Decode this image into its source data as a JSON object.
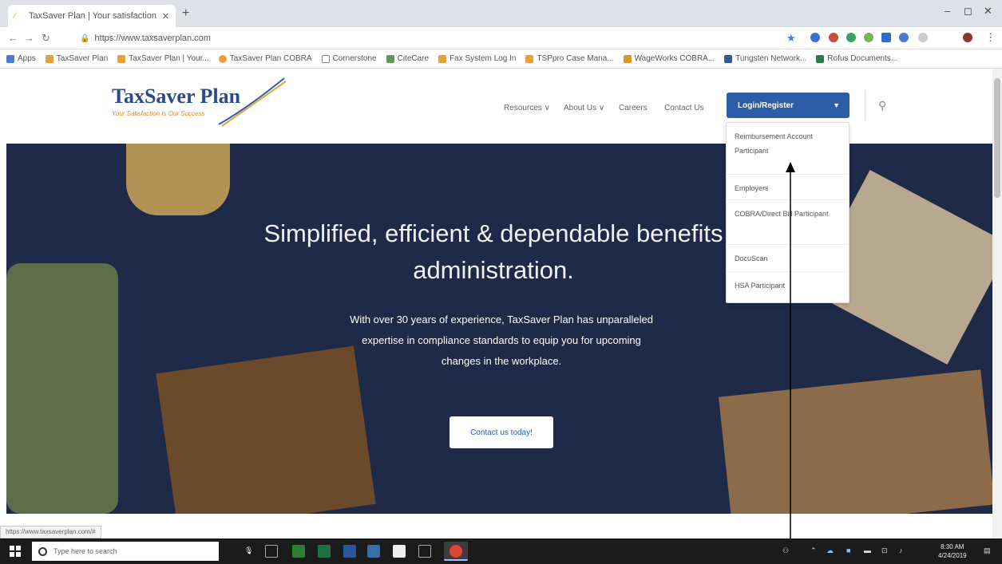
{
  "browser": {
    "tab_title": "TaxSaver Plan | Your satisfaction",
    "url": "https://www.taxsaverplan.com",
    "bookmarks": [
      {
        "label": "Apps",
        "color": "#4a7ad9"
      },
      {
        "label": "TaxSaver Plan",
        "color": "#e6a13c"
      },
      {
        "label": "TaxSaver Plan | Your...",
        "color": "#e6a13c"
      },
      {
        "label": "TaxSaver Plan COBRA",
        "color": "#e6a13c"
      },
      {
        "label": "Cornerstone",
        "color": "#888888"
      },
      {
        "label": "CiteCare",
        "color": "#5a9a5a"
      },
      {
        "label": "Fax System Log In",
        "color": "#e6a13c"
      },
      {
        "label": "TSPpro Case Mana...",
        "color": "#e6a13c"
      },
      {
        "label": "WageWorks COBRA...",
        "color": "#d99a2b"
      },
      {
        "label": "Tungsten Network...",
        "color": "#3b5998"
      },
      {
        "label": "Rofus Documents...",
        "color": "#2f7a4a"
      }
    ],
    "status_url": "https://www.taxsaverplan.com/#"
  },
  "site": {
    "brand": "TaxSaver Plan",
    "tagline": "Your Satisfaction Is Our Success",
    "nav": {
      "resources": "Resources ∨",
      "about": "About Us ∨",
      "careers": "Careers",
      "contact": "Contact Us",
      "login": "Login/Register"
    },
    "dropdown": [
      "Reimbursement Account Participant",
      "Employers",
      "COBRA/Direct Bill Participant",
      "DocuScan",
      "HSA Participant"
    ],
    "hero": {
      "headline_line1": "Simplified, efficient & dependable benefits",
      "headline_line2": "administration.",
      "sub_line1": "With over 30 years of experience, TaxSaver Plan has unparalleled",
      "sub_line2": "expertise in compliance standards to equip you for upcoming",
      "sub_line3": "changes in the workplace.",
      "cta": "Contact us today!"
    }
  },
  "taskbar": {
    "search_placeholder": "Type here to search",
    "time": "8:30 AM",
    "date": "4/24/2019"
  },
  "colors": {
    "brand_blue": "#2c5ea8",
    "hero_bg": "#1f2948"
  }
}
